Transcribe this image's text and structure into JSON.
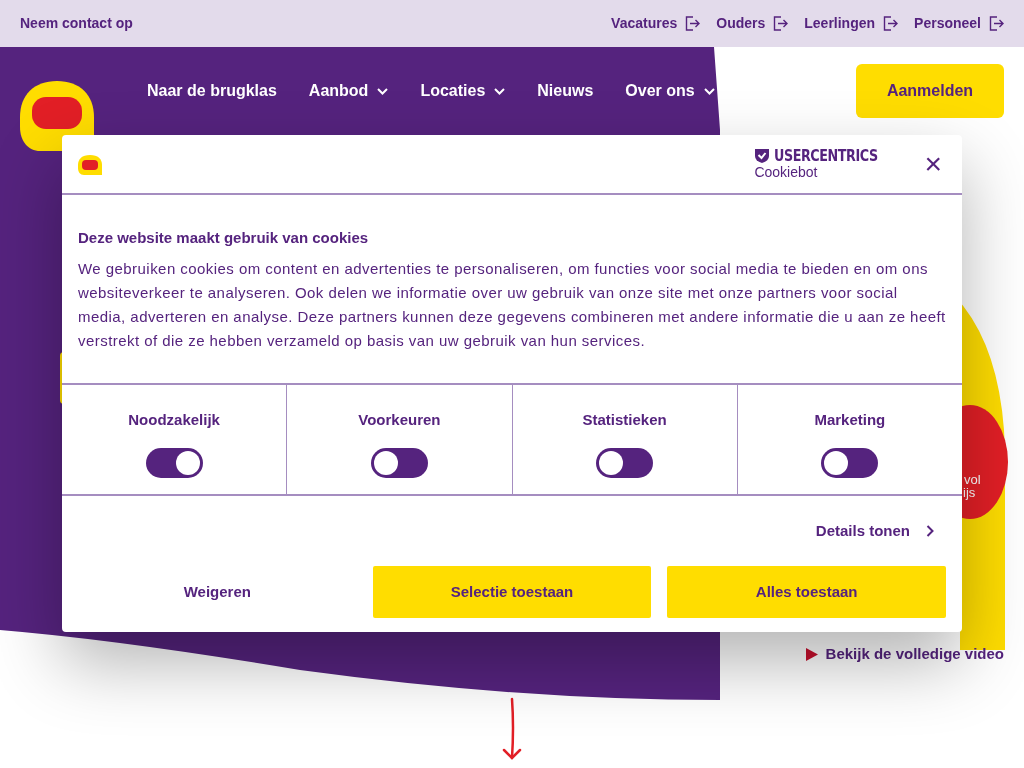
{
  "top_bar": {
    "contact": "Neem contact op",
    "links": [
      {
        "label": "Vacatures"
      },
      {
        "label": "Ouders"
      },
      {
        "label": "Leerlingen"
      },
      {
        "label": "Personeel"
      }
    ]
  },
  "nav": {
    "items": [
      {
        "label": "Naar de brugklas",
        "dropdown": false
      },
      {
        "label": "Aanbod",
        "dropdown": true
      },
      {
        "label": "Locaties",
        "dropdown": true
      },
      {
        "label": "Nieuws",
        "dropdown": false
      },
      {
        "label": "Over ons",
        "dropdown": true
      }
    ],
    "cta": "Aanmelden"
  },
  "badge": {
    "lines": [
      "vol",
      "ijs"
    ]
  },
  "video_link": "Bekijk de volledige video",
  "cookie_dialog": {
    "brand": {
      "name": "USERCENTRICS",
      "product": "Cookiebot"
    },
    "close": "×",
    "title": "Deze website maakt gebruik van cookies",
    "text": "We gebruiken cookies om content en advertenties te personaliseren, om functies voor social media te bieden en om ons websiteverkeer te analyseren. Ook delen we informatie over uw gebruik van onze site met onze partners voor social media, adverteren en analyse. Deze partners kunnen deze gegevens combineren met andere informatie die u aan ze heeft verstrekt of die ze hebben verzameld op basis van uw gebruik van hun services.",
    "categories": [
      {
        "label": "Noodzakelijk",
        "checked": true
      },
      {
        "label": "Voorkeuren",
        "checked": false
      },
      {
        "label": "Statistieken",
        "checked": false
      },
      {
        "label": "Marketing",
        "checked": false
      }
    ],
    "details": "Details tonen",
    "buttons": [
      {
        "label": "Weigeren",
        "kind": "plain"
      },
      {
        "label": "Selectie toestaan",
        "kind": "accent"
      },
      {
        "label": "Alles toestaan",
        "kind": "accent"
      }
    ]
  }
}
